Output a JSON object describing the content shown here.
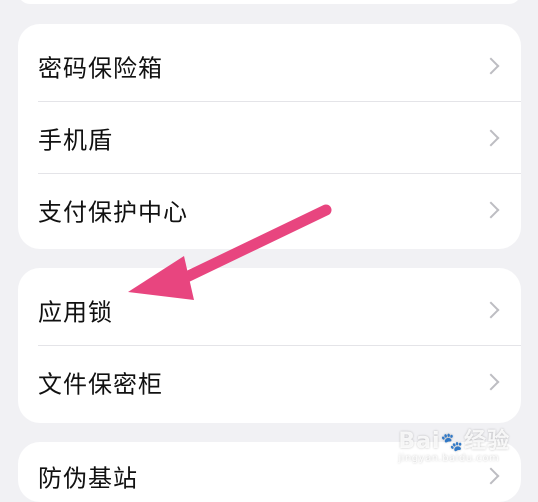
{
  "group1": {
    "items": [
      {
        "label": "密码保险箱"
      },
      {
        "label": "手机盾"
      },
      {
        "label": "支付保护中心"
      }
    ]
  },
  "group2": {
    "items": [
      {
        "label": "应用锁"
      },
      {
        "label": "文件保密柜"
      }
    ]
  },
  "group3": {
    "items": [
      {
        "label": "防伪基站"
      }
    ]
  },
  "annotation": {
    "arrow_color": "#e8457f"
  },
  "watermark": {
    "brand": "Bai",
    "brand_suffix": "经验",
    "domain": "jingyan.baidu.com"
  }
}
